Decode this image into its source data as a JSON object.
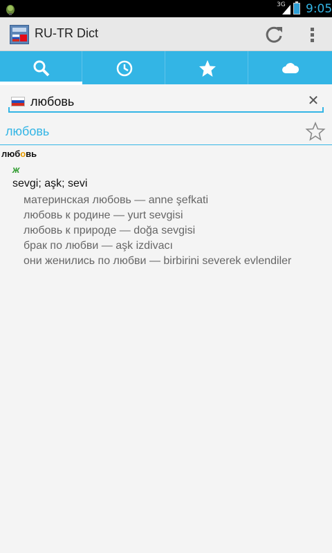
{
  "status_bar": {
    "network": "3G",
    "time": "9:05"
  },
  "action_bar": {
    "title": "RU-TR Dict",
    "icons": [
      "app-icon",
      "refresh-icon",
      "overflow-menu-icon"
    ]
  },
  "tabs": [
    {
      "icon": "search-icon",
      "selected": true
    },
    {
      "icon": "history-clock-icon",
      "selected": false
    },
    {
      "icon": "favorites-star-icon",
      "selected": false
    },
    {
      "icon": "cloud-icon",
      "selected": false
    }
  ],
  "search": {
    "value": "любовь",
    "language_flag": "ru-flag-icon"
  },
  "result": {
    "headword": "любовь",
    "entry_prefix": "люб",
    "entry_stress": "о",
    "entry_suffix": "вь",
    "gender": "ж",
    "translation": "sevgi; aşk; sevi",
    "examples": [
      "материнская любовь — anne şefkati",
      "любовь к родине — yurt sevgisi",
      "любовь к природе — doğa sevgisi",
      "брак по любви — aşk izdivacı",
      "они женились по любви — birbirini severek evlendiler"
    ]
  },
  "colors": {
    "accent": "#33b5e5",
    "gender": "#2e9b2e",
    "stress": "#e69b00"
  }
}
